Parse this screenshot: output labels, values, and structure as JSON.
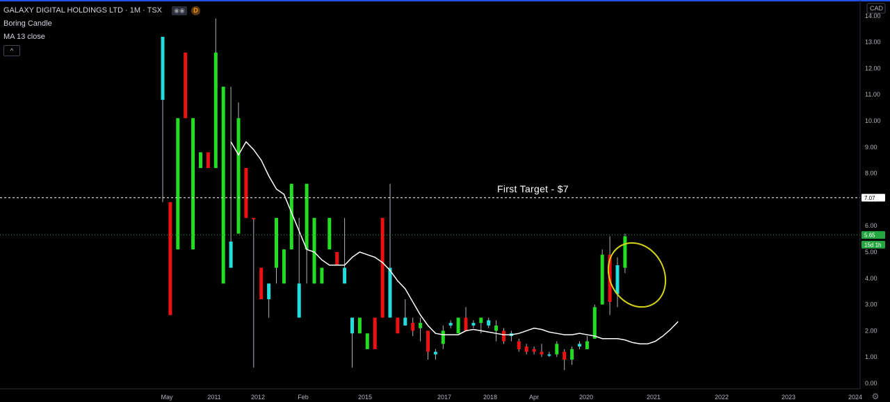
{
  "legend": {
    "symbol": "GALAXY DIGITAL HOLDINGS LTD · 1M · TSX",
    "badge": "D",
    "indicator1": "Boring Candle",
    "indicator2": "MA 13 close",
    "collapse": "^"
  },
  "axis": {
    "currency": "CAD",
    "last_price_label": "5.65",
    "countdown_label": "15d 1h",
    "target_price_label": "7.07",
    "settings_icon": "gear-icon"
  },
  "colors": {
    "up": "#22dd22",
    "down": "#ee1111",
    "boring": "#22dddd",
    "wick": "#b2b5be",
    "ma": "#ffffff",
    "ellipse": "#d7d41a",
    "price_tag": "#26a641",
    "target_tag": "#ffffff"
  },
  "chart_data": {
    "type": "candlestick",
    "title": "GALAXY DIGITAL HOLDINGS LTD · 1M · TSX",
    "ylim": [
      0,
      14
    ],
    "yticks": [
      "0.00",
      "1.00",
      "2.00",
      "3.00",
      "4.00",
      "5.00",
      "6.00",
      "7.00",
      "8.00",
      "9.00",
      "10.00",
      "11.00",
      "12.00",
      "13.00",
      "14.00"
    ],
    "xticks": [
      "May",
      "2011",
      "2012",
      "Feb",
      "2015",
      "2017",
      "2018",
      "Apr",
      "2020",
      "2021",
      "2022",
      "2023",
      "2024"
    ],
    "annotation": "First Target - $7",
    "target_price": 7.07,
    "last_price": 5.65,
    "series": [
      {
        "name": "Boring Candle",
        "candles": [
          {
            "o": 10.8,
            "h": 13.2,
            "l": 6.9,
            "c": 13.2,
            "kind": "boring"
          },
          {
            "o": 6.9,
            "h": 6.9,
            "l": 2.6,
            "c": 2.6,
            "kind": "down"
          },
          {
            "o": 5.1,
            "h": 10.1,
            "l": 5.1,
            "c": 10.1,
            "kind": "up"
          },
          {
            "o": 12.6,
            "h": 12.6,
            "l": 10.1,
            "c": 10.1,
            "kind": "down"
          },
          {
            "o": 5.1,
            "h": 10.1,
            "l": 5.1,
            "c": 10.1,
            "kind": "up"
          },
          {
            "o": 8.2,
            "h": 8.8,
            "l": 8.2,
            "c": 8.8,
            "kind": "up"
          },
          {
            "o": 8.8,
            "h": 8.8,
            "l": 8.2,
            "c": 8.2,
            "kind": "down"
          },
          {
            "o": 8.2,
            "h": 13.9,
            "l": 8.2,
            "c": 12.6,
            "kind": "up"
          },
          {
            "o": 3.8,
            "h": 11.3,
            "l": 3.8,
            "c": 11.3,
            "kind": "up"
          },
          {
            "o": 4.4,
            "h": 11.3,
            "l": 4.4,
            "c": 5.4,
            "kind": "boring"
          },
          {
            "o": 5.7,
            "h": 10.7,
            "l": 5.7,
            "c": 10.1,
            "kind": "up"
          },
          {
            "o": 8.2,
            "h": 8.2,
            "l": 6.3,
            "c": 6.3,
            "kind": "down"
          },
          {
            "o": 6.3,
            "h": 6.3,
            "l": 0.6,
            "c": 6.3,
            "kind": "down"
          },
          {
            "o": 4.4,
            "h": 4.4,
            "l": 3.2,
            "c": 3.2,
            "kind": "down"
          },
          {
            "o": 3.2,
            "h": 3.8,
            "l": 2.5,
            "c": 3.8,
            "kind": "boring"
          },
          {
            "o": 4.4,
            "h": 6.3,
            "l": 3.8,
            "c": 6.3,
            "kind": "up"
          },
          {
            "o": 3.8,
            "h": 5.1,
            "l": 3.8,
            "c": 5.1,
            "kind": "up"
          },
          {
            "o": 5.1,
            "h": 7.6,
            "l": 5.1,
            "c": 7.6,
            "kind": "up"
          },
          {
            "o": 3.8,
            "h": 6.3,
            "l": 2.5,
            "c": 2.5,
            "kind": "boring"
          },
          {
            "o": 5.1,
            "h": 7.6,
            "l": 3.8,
            "c": 7.6,
            "kind": "up"
          },
          {
            "o": 3.8,
            "h": 6.3,
            "l": 3.8,
            "c": 6.3,
            "kind": "up"
          },
          {
            "o": 3.8,
            "h": 4.4,
            "l": 3.8,
            "c": 4.4,
            "kind": "up"
          },
          {
            "o": 5.1,
            "h": 6.3,
            "l": 5.1,
            "c": 6.3,
            "kind": "up"
          },
          {
            "o": 5.0,
            "h": 5.0,
            "l": 4.5,
            "c": 4.5,
            "kind": "down"
          },
          {
            "o": 4.4,
            "h": 6.3,
            "l": 3.8,
            "c": 3.8,
            "kind": "boring"
          },
          {
            "o": 2.5,
            "h": 2.5,
            "l": 0.6,
            "c": 1.9,
            "kind": "boring"
          },
          {
            "o": 1.9,
            "h": 2.5,
            "l": 1.9,
            "c": 2.5,
            "kind": "up"
          },
          {
            "o": 1.3,
            "h": 1.9,
            "l": 1.3,
            "c": 1.9,
            "kind": "up"
          },
          {
            "o": 2.5,
            "h": 2.5,
            "l": 1.3,
            "c": 1.3,
            "kind": "down"
          },
          {
            "o": 6.3,
            "h": 6.3,
            "l": 2.5,
            "c": 2.5,
            "kind": "down"
          },
          {
            "o": 4.4,
            "h": 7.6,
            "l": 2.5,
            "c": 2.5,
            "kind": "boring"
          },
          {
            "o": 2.5,
            "h": 2.5,
            "l": 1.9,
            "c": 1.9,
            "kind": "down"
          },
          {
            "o": 2.5,
            "h": 3.2,
            "l": 2.2,
            "c": 2.2,
            "kind": "boring"
          },
          {
            "o": 2.3,
            "h": 2.5,
            "l": 1.8,
            "c": 2.0,
            "kind": "down"
          },
          {
            "o": 2.1,
            "h": 2.5,
            "l": 1.6,
            "c": 2.3,
            "kind": "up"
          },
          {
            "o": 2.0,
            "h": 2.0,
            "l": 0.9,
            "c": 1.2,
            "kind": "down"
          },
          {
            "o": 1.2,
            "h": 1.3,
            "l": 0.9,
            "c": 1.1,
            "kind": "boring"
          },
          {
            "o": 1.5,
            "h": 2.2,
            "l": 1.3,
            "c": 2.0,
            "kind": "up"
          },
          {
            "o": 2.3,
            "h": 2.4,
            "l": 2.1,
            "c": 2.2,
            "kind": "boring"
          },
          {
            "o": 1.9,
            "h": 2.5,
            "l": 1.9,
            "c": 2.5,
            "kind": "up"
          },
          {
            "o": 2.5,
            "h": 2.9,
            "l": 2.0,
            "c": 2.0,
            "kind": "down"
          },
          {
            "o": 2.2,
            "h": 2.4,
            "l": 2.1,
            "c": 2.3,
            "kind": "boring"
          },
          {
            "o": 2.3,
            "h": 2.5,
            "l": 1.9,
            "c": 2.5,
            "kind": "up"
          },
          {
            "o": 2.4,
            "h": 2.5,
            "l": 2.1,
            "c": 2.2,
            "kind": "boring"
          },
          {
            "o": 2.0,
            "h": 2.4,
            "l": 1.6,
            "c": 2.2,
            "kind": "up"
          },
          {
            "o": 2.0,
            "h": 2.1,
            "l": 1.5,
            "c": 1.6,
            "kind": "down"
          },
          {
            "o": 1.9,
            "h": 2.0,
            "l": 1.6,
            "c": 1.8,
            "kind": "boring"
          },
          {
            "o": 1.6,
            "h": 1.7,
            "l": 1.2,
            "c": 1.3,
            "kind": "down"
          },
          {
            "o": 1.4,
            "h": 1.5,
            "l": 1.1,
            "c": 1.2,
            "kind": "down"
          },
          {
            "o": 1.3,
            "h": 1.4,
            "l": 1.1,
            "c": 1.2,
            "kind": "down"
          },
          {
            "o": 1.2,
            "h": 1.5,
            "l": 1.0,
            "c": 1.1,
            "kind": "down"
          },
          {
            "o": 1.1,
            "h": 1.2,
            "l": 1.0,
            "c": 1.1,
            "kind": "boring"
          },
          {
            "o": 1.1,
            "h": 1.6,
            "l": 1.0,
            "c": 1.5,
            "kind": "up"
          },
          {
            "o": 1.2,
            "h": 1.3,
            "l": 0.5,
            "c": 0.9,
            "kind": "down"
          },
          {
            "o": 0.9,
            "h": 1.4,
            "l": 0.7,
            "c": 1.3,
            "kind": "up"
          },
          {
            "o": 1.4,
            "h": 1.6,
            "l": 1.3,
            "c": 1.5,
            "kind": "boring"
          },
          {
            "o": 1.3,
            "h": 1.8,
            "l": 1.3,
            "c": 1.6,
            "kind": "up"
          },
          {
            "o": 1.7,
            "h": 3.0,
            "l": 1.7,
            "c": 2.9,
            "kind": "up"
          },
          {
            "o": 3.0,
            "h": 5.1,
            "l": 3.0,
            "c": 4.9,
            "kind": "up"
          },
          {
            "o": 4.9,
            "h": 5.6,
            "l": 2.6,
            "c": 3.1,
            "kind": "down"
          },
          {
            "o": 3.4,
            "h": 4.8,
            "l": 2.9,
            "c": 4.5,
            "kind": "boring"
          },
          {
            "o": 4.4,
            "h": 5.7,
            "l": 4.2,
            "c": 5.6,
            "kind": "up"
          }
        ]
      },
      {
        "name": "MA 13 close",
        "points": [
          {
            "i": 9,
            "v": 9.2
          },
          {
            "i": 10,
            "v": 8.7
          },
          {
            "i": 11,
            "v": 9.2
          },
          {
            "i": 12,
            "v": 8.9
          },
          {
            "i": 13,
            "v": 8.5
          },
          {
            "i": 14,
            "v": 7.9
          },
          {
            "i": 15,
            "v": 7.4
          },
          {
            "i": 16,
            "v": 7.2
          },
          {
            "i": 17,
            "v": 6.5
          },
          {
            "i": 18,
            "v": 5.8
          },
          {
            "i": 19,
            "v": 5.1
          },
          {
            "i": 20,
            "v": 5.0
          },
          {
            "i": 21,
            "v": 4.7
          },
          {
            "i": 22,
            "v": 4.5
          },
          {
            "i": 23,
            "v": 4.5
          },
          {
            "i": 24,
            "v": 4.5
          },
          {
            "i": 25,
            "v": 4.8
          },
          {
            "i": 26,
            "v": 5.0
          },
          {
            "i": 27,
            "v": 4.9
          },
          {
            "i": 28,
            "v": 4.8
          },
          {
            "i": 29,
            "v": 4.6
          },
          {
            "i": 30,
            "v": 4.3
          },
          {
            "i": 31,
            "v": 3.9
          },
          {
            "i": 32,
            "v": 3.6
          },
          {
            "i": 33,
            "v": 3.1
          },
          {
            "i": 34,
            "v": 2.6
          },
          {
            "i": 35,
            "v": 2.2
          },
          {
            "i": 36,
            "v": 1.9
          },
          {
            "i": 37,
            "v": 1.85
          },
          {
            "i": 38,
            "v": 1.85
          },
          {
            "i": 39,
            "v": 1.85
          },
          {
            "i": 40,
            "v": 2.0
          },
          {
            "i": 41,
            "v": 2.05
          },
          {
            "i": 42,
            "v": 2.0
          },
          {
            "i": 43,
            "v": 1.95
          },
          {
            "i": 44,
            "v": 1.9
          },
          {
            "i": 45,
            "v": 1.85
          },
          {
            "i": 46,
            "v": 1.85
          },
          {
            "i": 47,
            "v": 1.9
          },
          {
            "i": 48,
            "v": 2.0
          },
          {
            "i": 49,
            "v": 2.1
          },
          {
            "i": 50,
            "v": 2.05
          },
          {
            "i": 51,
            "v": 1.95
          },
          {
            "i": 52,
            "v": 1.9
          },
          {
            "i": 53,
            "v": 1.85
          },
          {
            "i": 54,
            "v": 1.85
          },
          {
            "i": 55,
            "v": 1.9
          },
          {
            "i": 56,
            "v": 1.85
          },
          {
            "i": 57,
            "v": 1.8
          },
          {
            "i": 58,
            "v": 1.7
          },
          {
            "i": 59,
            "v": 1.7
          },
          {
            "i": 60,
            "v": 1.7
          },
          {
            "i": 61,
            "v": 1.65
          },
          {
            "i": 62,
            "v": 1.55
          },
          {
            "i": 63,
            "v": 1.5
          },
          {
            "i": 64,
            "v": 1.5
          },
          {
            "i": 65,
            "v": 1.6
          },
          {
            "i": 66,
            "v": 1.8
          },
          {
            "i": 67,
            "v": 2.05
          },
          {
            "i": 68,
            "v": 2.35
          }
        ]
      }
    ]
  }
}
